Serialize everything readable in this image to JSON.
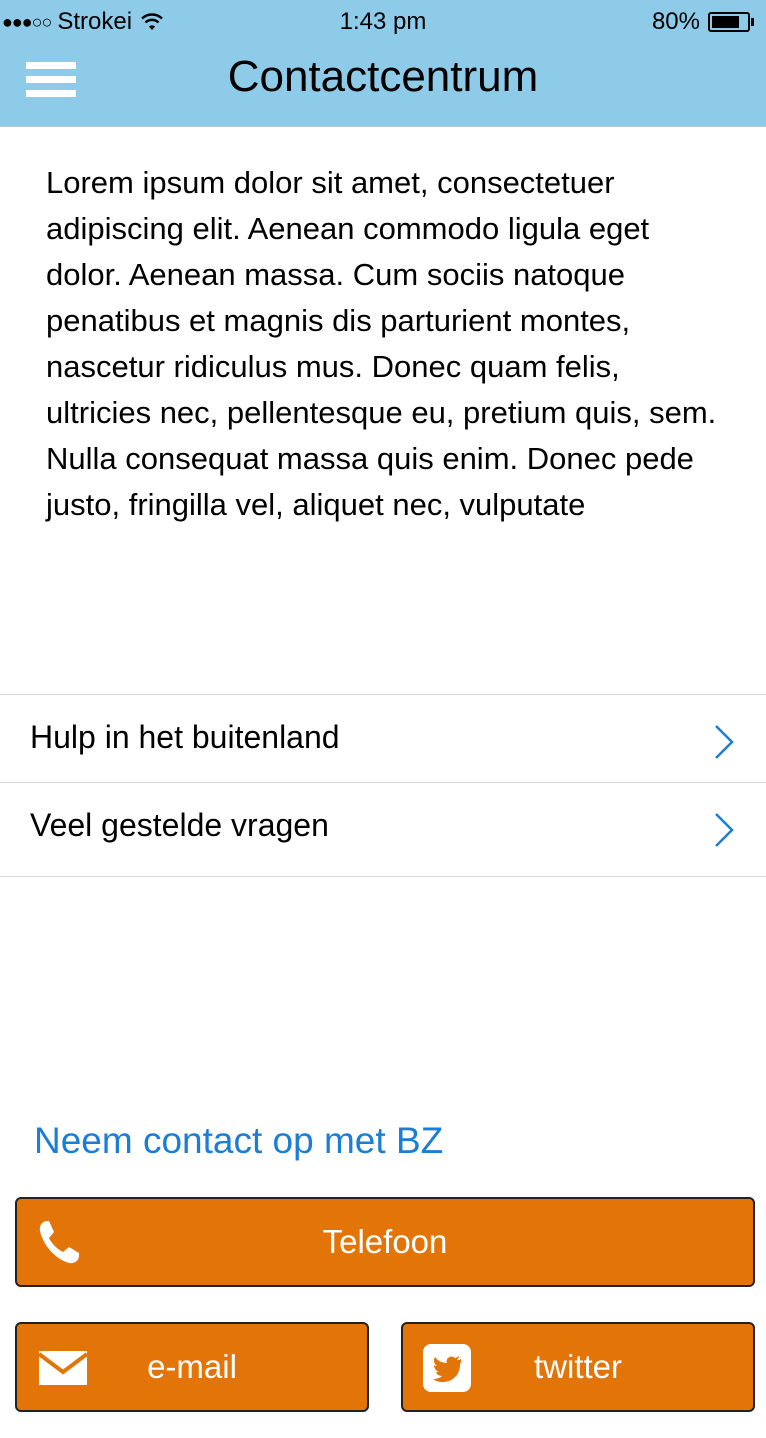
{
  "status_bar": {
    "signal": "●●●○○",
    "carrier": "Strokei",
    "time": "1:43 pm",
    "battery_percent": "80%",
    "battery_level": 0.8
  },
  "header": {
    "title": "Contactcentrum",
    "menu_icon": "hamburger-menu-icon"
  },
  "intro": {
    "text": "Lorem ipsum dolor sit amet, consectetuer adipiscing elit. Aenean commodo ligula eget dolor. Aenean massa. Cum sociis natoque penatibus et magnis dis parturient montes, nascetur ridiculus mus. Donec quam felis, ultricies nec, pellentesque eu, pretium quis, sem. Nulla consequat massa quis enim. Donec pede justo, fringilla vel, aliquet nec, vulputate"
  },
  "list": {
    "items": [
      {
        "label": "Hulp in het buitenland"
      },
      {
        "label": "Veel gestelde vragen"
      }
    ]
  },
  "contact": {
    "heading": "Neem contact op met BZ",
    "phone_label": "Telefoon",
    "email_label": "e-mail",
    "twitter_label": "twitter"
  },
  "colors": {
    "header_bg": "#8ecbe8",
    "accent_blue": "#1a7ed6",
    "button_orange": "#e37508"
  }
}
